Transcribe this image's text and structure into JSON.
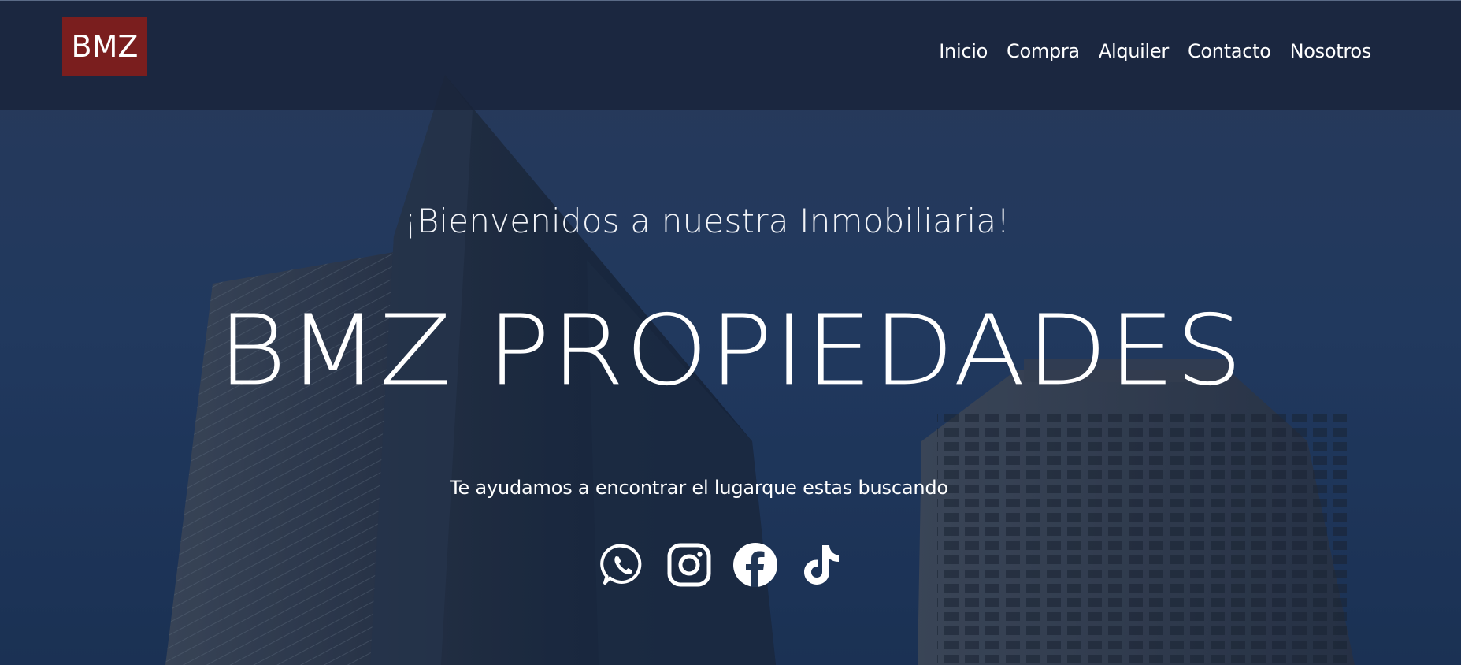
{
  "header": {
    "logo_text": "BMZ",
    "nav": [
      {
        "label": "Inicio"
      },
      {
        "label": "Compra"
      },
      {
        "label": "Alquiler"
      },
      {
        "label": "Contacto"
      },
      {
        "label": "Nosotros"
      }
    ]
  },
  "hero": {
    "welcome": "¡Bienvenidos a nuestra Inmobiliaria!",
    "title": "BMZ PROPIEDADES",
    "tagline": "Te ayudamos a encontrar el lugarque estas buscando"
  },
  "social": [
    {
      "icon": "whatsapp-icon"
    },
    {
      "icon": "instagram-icon"
    },
    {
      "icon": "facebook-icon"
    },
    {
      "icon": "tiktok-icon"
    }
  ],
  "colors": {
    "logo_bg": "#7a1e1e",
    "header_bg": "#182238",
    "hero_bg": "#223a62",
    "text": "#ffffff"
  }
}
